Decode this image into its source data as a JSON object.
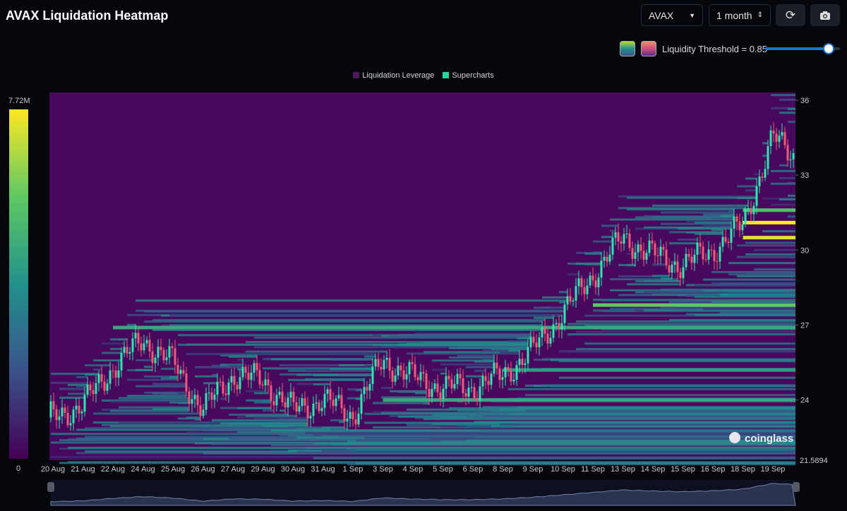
{
  "header": {
    "title": "AVAX Liquidation Heatmap",
    "coin": "AVAX",
    "period": "1 month",
    "refresh_icon": "refresh-icon",
    "camera_icon": "camera-icon"
  },
  "controls": {
    "threshold_label": "Liquidity Threshold = 0.85",
    "threshold_value": 0.85,
    "palette_colors": [
      "#21918c",
      "#e0607a"
    ]
  },
  "colorbar": {
    "max_label": "7.72M",
    "min_label": "0"
  },
  "watermark": "coinglass",
  "chart_data": {
    "type": "heatmap",
    "title": "AVAX Liquidation Heatmap",
    "legend": [
      "Liquidation Leverage",
      "Supercharts"
    ],
    "legend_colors": [
      "#4a1a5a",
      "#1fd79a"
    ],
    "legend_placement": "top-center",
    "x_ticks": [
      "20 Aug",
      "21 Aug",
      "22 Aug",
      "24 Aug",
      "25 Aug",
      "26 Aug",
      "27 Aug",
      "29 Aug",
      "30 Aug",
      "31 Aug",
      "1 Sep",
      "3 Sep",
      "4 Sep",
      "5 Sep",
      "6 Sep",
      "8 Sep",
      "9 Sep",
      "10 Sep",
      "11 Sep",
      "13 Sep",
      "14 Sep",
      "15 Sep",
      "16 Sep",
      "18 Sep",
      "19 Sep"
    ],
    "y_ticks": [
      36,
      33,
      30,
      27,
      24
    ],
    "y_min_label": "21.5894",
    "ylim": [
      21.5894,
      36.3
    ],
    "price_path": [
      23.3,
      23.8,
      25.3,
      26.4,
      25.5,
      23.6,
      25.0,
      24.8,
      23.6,
      24.0,
      23.4,
      25.6,
      24.9,
      24.5,
      24.5,
      25.0,
      26.0,
      27.5,
      29.0,
      30.5,
      29.8,
      29.4,
      30.0,
      31.0,
      34.5,
      33.8
    ],
    "key_bands": [
      {
        "price": 31.1,
        "from_tick": 23,
        "intensity": 1.0
      },
      {
        "price": 30.5,
        "from_tick": 23,
        "intensity": 0.95
      },
      {
        "price": 31.6,
        "from_tick": 23,
        "intensity": 0.7
      },
      {
        "price": 27.8,
        "from_tick": 18,
        "intensity": 0.75
      },
      {
        "price": 26.9,
        "from_tick": 2,
        "intensity": 0.6
      },
      {
        "price": 24.0,
        "from_tick": 11,
        "intensity": 0.6
      },
      {
        "price": 25.2,
        "from_tick": 15,
        "intensity": 0.55
      }
    ],
    "colorscale_max": "7.72M"
  }
}
